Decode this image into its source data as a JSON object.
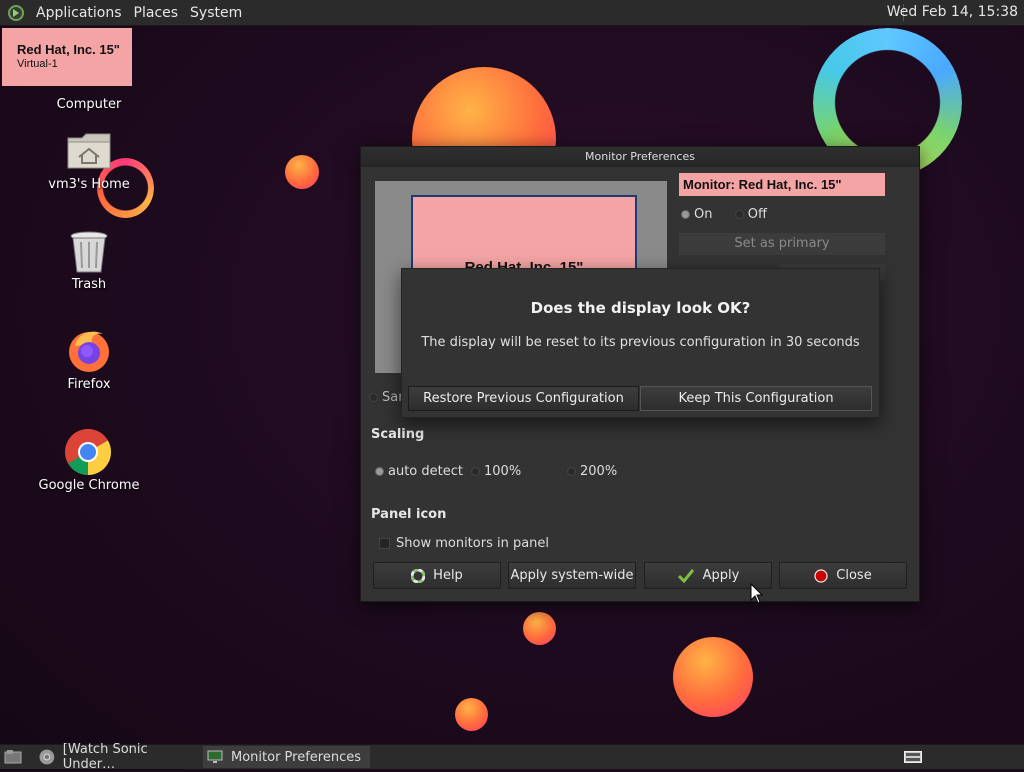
{
  "top_panel": {
    "menus": [
      "Applications",
      "Places",
      "System"
    ],
    "clock": "Wed Feb 14, 15:38"
  },
  "osd": {
    "monitor_name": "Red Hat, Inc. 15\"",
    "output": "Virtual-1"
  },
  "desktop_icons": [
    {
      "label": "Computer",
      "icon": "computer-icon"
    },
    {
      "label": "vm3's Home",
      "icon": "home-folder-icon"
    },
    {
      "label": "Trash",
      "icon": "trash-icon"
    },
    {
      "label": "Firefox",
      "icon": "firefox-icon"
    },
    {
      "label": "Google Chrome",
      "icon": "chrome-icon"
    }
  ],
  "window": {
    "title": "Monitor Preferences",
    "preview_label": "Red Hat, Inc. 15\"",
    "monitor_label": "Monitor: Red Hat, Inc. 15\"",
    "on_label": "On",
    "off_label": "Off",
    "power_state": "On",
    "set_primary": "Set as primary",
    "same_image_partial": "Sar",
    "scaling_title": "Scaling",
    "scaling_options": [
      "auto detect",
      "100%",
      "200%"
    ],
    "scaling_selected": "auto detect",
    "panel_icon_title": "Panel icon",
    "show_monitors": "Show monitors in panel",
    "show_monitors_checked": false,
    "buttons": {
      "help": "Help",
      "apply_system_wide": "Apply system-wide",
      "apply": "Apply",
      "close": "Close"
    }
  },
  "dialog": {
    "title": "Does the display look OK?",
    "message": "The display will be reset to its previous configuration in 30 seconds",
    "restore": "Restore Previous Configuration",
    "keep": "Keep This Configuration"
  },
  "taskbar": {
    "tasks": [
      {
        "label": "[Watch Sonic Under…",
        "icon": "chrome-icon",
        "active": false
      },
      {
        "label": "Monitor Preferences",
        "icon": "monitor-icon",
        "active": true
      }
    ]
  },
  "colors": {
    "osd_background": "#f4a4a4",
    "panel": "#2b2b2b",
    "window": "#333333"
  }
}
